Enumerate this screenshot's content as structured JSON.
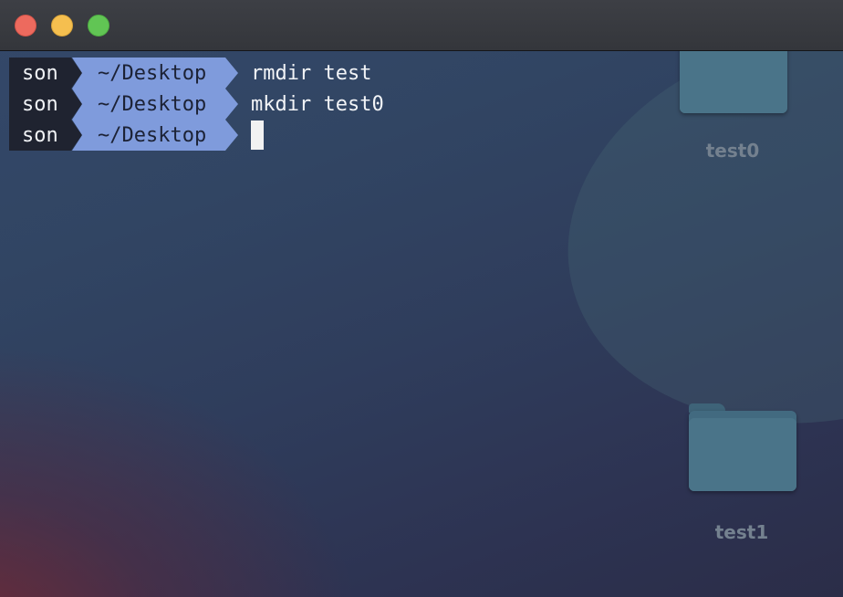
{
  "window": {
    "controls": [
      "close",
      "minimize",
      "zoom"
    ]
  },
  "terminal": {
    "lines": [
      {
        "user": "son",
        "dir": "~/Desktop",
        "command": "rmdir test"
      },
      {
        "user": "son",
        "dir": "~/Desktop",
        "command": "mkdir test0"
      },
      {
        "user": "son",
        "dir": "~/Desktop",
        "command": ""
      }
    ],
    "prompt_colors": {
      "user_bg": "#1f2330",
      "dir_bg": "#7f9bdc"
    }
  },
  "desktop": {
    "items": [
      {
        "name": "test0",
        "icon": "folder-icon"
      },
      {
        "name": "test1",
        "icon": "folder-icon"
      }
    ]
  }
}
